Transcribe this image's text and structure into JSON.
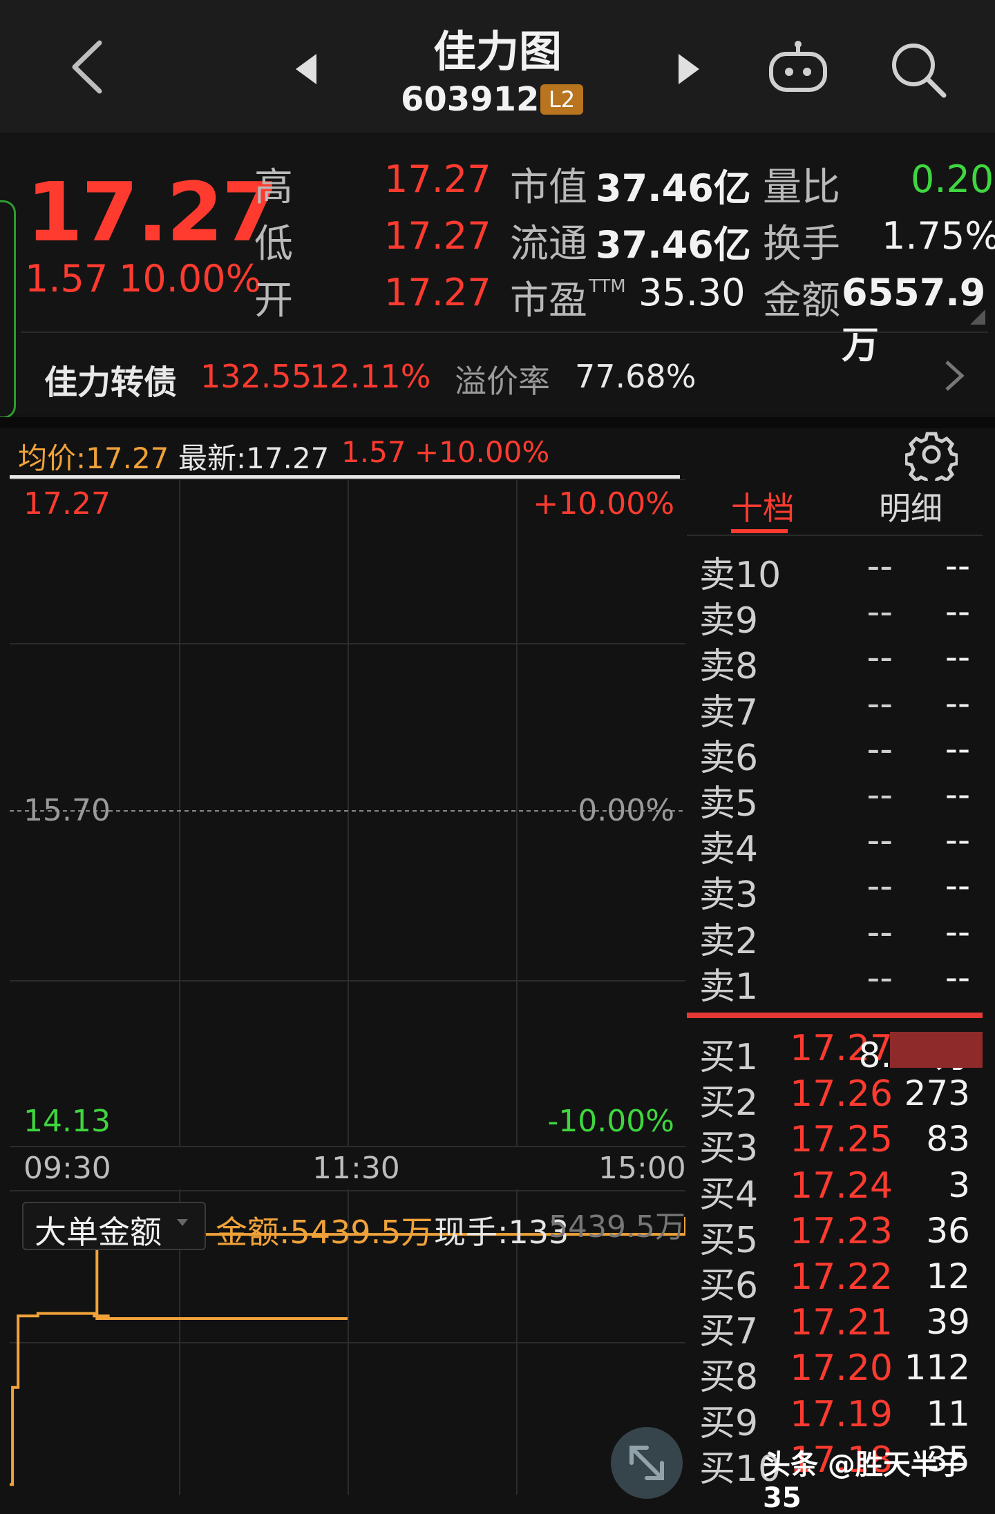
{
  "header": {
    "title": "佳力图",
    "code": "603912",
    "badge": "L2"
  },
  "quote": {
    "price": "17.27",
    "change": "1.57",
    "change_pct": "10.00%",
    "stats": [
      {
        "label": "高",
        "value": "17.27"
      },
      {
        "label": "低",
        "value": "17.27"
      },
      {
        "label": "开",
        "value": "17.27"
      }
    ],
    "market": [
      {
        "label": "市值",
        "value": "37.46亿"
      },
      {
        "label": "流通",
        "value": "37.46亿"
      },
      {
        "label": "市盈",
        "sup": "TTM",
        "value": "35.30"
      }
    ],
    "extra": [
      {
        "label": "量比",
        "value": "0.20"
      },
      {
        "label": "换手",
        "value": "1.75%"
      },
      {
        "label": "金额",
        "value": "6557.9万"
      }
    ]
  },
  "convertible": {
    "name": "佳力转债",
    "price": "132.55",
    "pct": "12.11%",
    "premium_label": "溢价率",
    "premium": "77.68%"
  },
  "intraday": {
    "avg": "均价:17.27",
    "latest": "最新:17.27",
    "change": "1.57",
    "change_pct": "+10.00%"
  },
  "chart_data": {
    "type": "line",
    "y_labels_left": [
      "17.27",
      "15.70",
      "14.13"
    ],
    "y_labels_right": [
      "+10.00%",
      "0.00%",
      "-10.00%"
    ],
    "x_labels": [
      "09:30",
      "11:30",
      "15:00"
    ],
    "ylim": [
      14.13,
      17.27
    ],
    "series": [],
    "lower_panel": {
      "selector": "大单金额",
      "amount": "金额:5439.5万",
      "hand": "现手:133",
      "right_label": "5439.5万",
      "line_color": "#f0a23a",
      "x": [
        "09:30",
        "09:31",
        "09:33",
        "09:35",
        "09:40",
        "10:00",
        "10:05",
        "11:00",
        "11:30",
        "11:31",
        "15:00"
      ],
      "y": [
        200,
        2100,
        3500,
        3500,
        3550,
        3500,
        3450,
        3450,
        3450,
        5100,
        5439.5
      ]
    }
  },
  "orderbook": {
    "tabs": [
      "十档",
      "明细"
    ],
    "sell": [
      {
        "label": "卖10",
        "price": "--",
        "vol": "--"
      },
      {
        "label": "卖9",
        "price": "--",
        "vol": "--"
      },
      {
        "label": "卖8",
        "price": "--",
        "vol": "--"
      },
      {
        "label": "卖7",
        "price": "--",
        "vol": "--"
      },
      {
        "label": "卖6",
        "price": "--",
        "vol": "--"
      },
      {
        "label": "卖5",
        "price": "--",
        "vol": "--"
      },
      {
        "label": "卖4",
        "price": "--",
        "vol": "--"
      },
      {
        "label": "卖3",
        "price": "--",
        "vol": "--"
      },
      {
        "label": "卖2",
        "price": "--",
        "vol": "--"
      },
      {
        "label": "卖1",
        "price": "--",
        "vol": "--"
      }
    ],
    "buy": [
      {
        "label": "买1",
        "price": "17.27",
        "vol": "8.07万"
      },
      {
        "label": "买2",
        "price": "17.26",
        "vol": "273"
      },
      {
        "label": "买3",
        "price": "17.25",
        "vol": "83"
      },
      {
        "label": "买4",
        "price": "17.24",
        "vol": "3"
      },
      {
        "label": "买5",
        "price": "17.23",
        "vol": "36"
      },
      {
        "label": "买6",
        "price": "17.22",
        "vol": "12"
      },
      {
        "label": "买7",
        "price": "17.21",
        "vol": "39"
      },
      {
        "label": "买8",
        "price": "17.20",
        "vol": "112"
      },
      {
        "label": "买9",
        "price": "17.19",
        "vol": "11"
      },
      {
        "label": "买10",
        "price": "17.18",
        "vol": "35"
      }
    ]
  },
  "watermark": "头条 @胜天半子35",
  "colors": {
    "up": "#ff3b30",
    "down": "#3fd63f",
    "avg": "#f0a23a",
    "bg": "#121212"
  },
  "icons": [
    "back-icon",
    "prev-stock-icon",
    "next-stock-icon",
    "robot-icon",
    "search-icon",
    "gear-icon",
    "chevron-right-icon",
    "expand-icon"
  ]
}
